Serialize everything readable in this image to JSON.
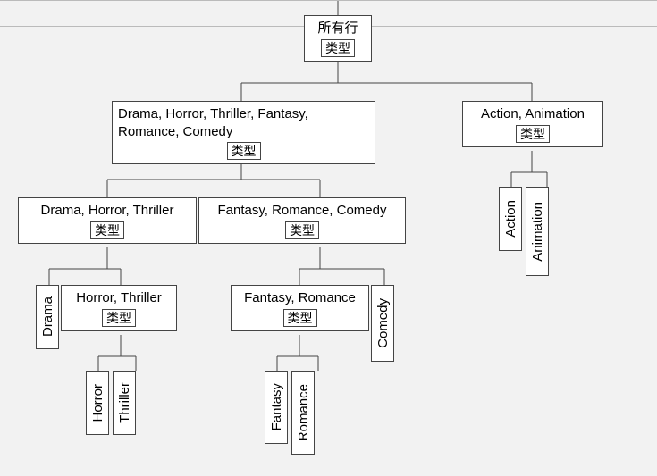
{
  "root": {
    "title": "所有行",
    "sub": "类型"
  },
  "left": {
    "title": "Drama, Horror, Thriller, Fantasy, Romance, Comedy",
    "sub": "类型"
  },
  "right": {
    "title": "Action, Animation",
    "sub": "类型"
  },
  "dht": {
    "title": "Drama, Horror, Thriller",
    "sub": "类型"
  },
  "frc": {
    "title": "Fantasy, Romance, Comedy",
    "sub": "类型"
  },
  "ht": {
    "title": "Horror, Thriller",
    "sub": "类型"
  },
  "fr": {
    "title": "Fantasy, Romance",
    "sub": "类型"
  },
  "leaves": {
    "drama": "Drama",
    "horror": "Horror",
    "thriller": "Thriller",
    "fantasy": "Fantasy",
    "romance": "Romance",
    "comedy": "Comedy",
    "action": "Action",
    "animation": "Animation"
  }
}
